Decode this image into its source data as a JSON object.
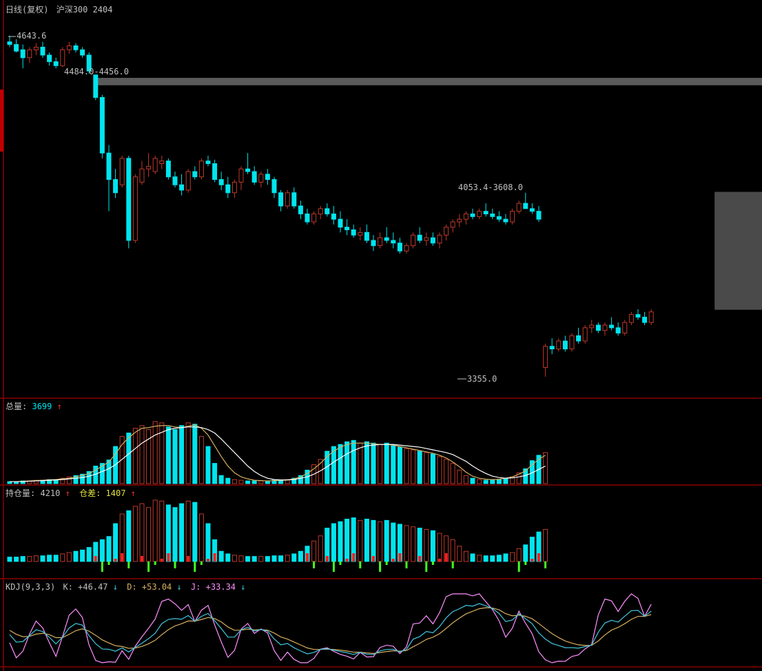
{
  "header": {
    "period": "日线(复权)",
    "symbol": "沪深300 2404"
  },
  "colors": {
    "background": "#000000",
    "border": "#8b0000",
    "up": "#c0392b",
    "down": "#00e5ee",
    "label": "#c0c0c0",
    "gap_box": "#4a4a4a",
    "kdj_k": "#ff90ff",
    "kdj_d": "#d8b060",
    "kdj_j": "#40c8e0",
    "vol_ma1": "#d8b060",
    "vol_ma2": "#ffffff",
    "oi_change_pos": "#ff2020",
    "oi_change_neg": "#44ff22"
  },
  "annotations": {
    "high": "4643.6",
    "gap1": "4484.0-4456.0",
    "gap2": "4053.4-3608.0",
    "low": "3355.0"
  },
  "volume_panel": {
    "label": "总量:",
    "value": "3699",
    "arrow": "↑"
  },
  "oi_panel": {
    "label": "持仓量:",
    "value": "4210",
    "arrow1": "↑",
    "label2": "仓差:",
    "value2": "1407",
    "arrow2": "↑"
  },
  "kdj_panel": {
    "label": "KDJ(9,3,3)",
    "k_label": "K:",
    "k_value": "+46.47",
    "k_arrow": "↓",
    "d_label": "D:",
    "d_value": "+53.04",
    "d_arrow": "↓",
    "j_label": "J:",
    "j_value": "+33.34",
    "j_arrow": "↓"
  },
  "chart_data": {
    "type": "candlestick",
    "ylim": [
      3300,
      4700
    ],
    "gaps": [
      {
        "high": 4484.0,
        "low": 4456.0,
        "start_index": 13
      },
      {
        "high": 4053.4,
        "low": 3608.0,
        "start_index": 107
      }
    ],
    "candles": [
      [
        4620,
        4643.6,
        4600,
        4610
      ],
      [
        4610,
        4630,
        4580,
        4585
      ],
      [
        4590,
        4610,
        4520,
        4560
      ],
      [
        4560,
        4600,
        4540,
        4590
      ],
      [
        4590,
        4615,
        4570,
        4600
      ],
      [
        4600,
        4620,
        4560,
        4570
      ],
      [
        4570,
        4580,
        4530,
        4545
      ],
      [
        4545,
        4560,
        4520,
        4530
      ],
      [
        4530,
        4600,
        4525,
        4590
      ],
      [
        4590,
        4620,
        4575,
        4605
      ],
      [
        4605,
        4615,
        4580,
        4590
      ],
      [
        4590,
        4600,
        4560,
        4570
      ],
      [
        4570,
        4580,
        4500,
        4510
      ],
      [
        4495,
        4484,
        4400,
        4410
      ],
      [
        4410,
        4420,
        4180,
        4200
      ],
      [
        4200,
        4230,
        3980,
        4100
      ],
      [
        4100,
        4140,
        4030,
        4050
      ],
      [
        4080,
        4190,
        4070,
        4180
      ],
      [
        4180,
        4190,
        3840,
        3870
      ],
      [
        3870,
        4120,
        3860,
        4110
      ],
      [
        4090,
        4170,
        4080,
        4140
      ],
      [
        4140,
        4200,
        4110,
        4150
      ],
      [
        4130,
        4190,
        4120,
        4180
      ],
      [
        4160,
        4190,
        4140,
        4170
      ],
      [
        4170,
        4180,
        4100,
        4110
      ],
      [
        4110,
        4130,
        4070,
        4080
      ],
      [
        4080,
        4120,
        4040,
        4060
      ],
      [
        4060,
        4140,
        4050,
        4130
      ],
      [
        4130,
        4150,
        4100,
        4110
      ],
      [
        4110,
        4180,
        4100,
        4170
      ],
      [
        4170,
        4190,
        4150,
        4160
      ],
      [
        4160,
        4175,
        4090,
        4100
      ],
      [
        4100,
        4130,
        4060,
        4080
      ],
      [
        4080,
        4110,
        4030,
        4050
      ],
      [
        4050,
        4100,
        4030,
        4090
      ],
      [
        4090,
        4150,
        4060,
        4140
      ],
      [
        4140,
        4200,
        4120,
        4130
      ],
      [
        4130,
        4150,
        4080,
        4090
      ],
      [
        4090,
        4130,
        4070,
        4120
      ],
      [
        4120,
        4140,
        4080,
        4100
      ],
      [
        4100,
        4110,
        4030,
        4050
      ],
      [
        4050,
        4060,
        3980,
        4000
      ],
      [
        4000,
        4060,
        3990,
        4050
      ],
      [
        4050,
        4070,
        3990,
        4000
      ],
      [
        4000,
        4020,
        3950,
        3970
      ],
      [
        3970,
        3990,
        3930,
        3940
      ],
      [
        3940,
        3980,
        3930,
        3970
      ],
      [
        3970,
        4000,
        3950,
        3990
      ],
      [
        3990,
        4010,
        3960,
        3970
      ],
      [
        3970,
        4000,
        3930,
        3950
      ],
      [
        3950,
        3980,
        3900,
        3920
      ],
      [
        3920,
        3950,
        3890,
        3910
      ],
      [
        3910,
        3930,
        3880,
        3890
      ],
      [
        3890,
        3920,
        3870,
        3900
      ],
      [
        3900,
        3930,
        3860,
        3870
      ],
      [
        3870,
        3890,
        3830,
        3850
      ],
      [
        3850,
        3900,
        3840,
        3880
      ],
      [
        3880,
        3920,
        3860,
        3870
      ],
      [
        3870,
        3900,
        3840,
        3860
      ],
      [
        3860,
        3880,
        3820,
        3830
      ],
      [
        3830,
        3860,
        3820,
        3850
      ],
      [
        3850,
        3900,
        3840,
        3890
      ],
      [
        3890,
        3920,
        3860,
        3870
      ],
      [
        3870,
        3900,
        3850,
        3880
      ],
      [
        3880,
        3900,
        3850,
        3860
      ],
      [
        3860,
        3900,
        3840,
        3890
      ],
      [
        3890,
        3930,
        3870,
        3920
      ],
      [
        3920,
        3950,
        3900,
        3940
      ],
      [
        3940,
        3970,
        3920,
        3950
      ],
      [
        3950,
        3980,
        3930,
        3970
      ],
      [
        3970,
        3990,
        3950,
        3960
      ],
      [
        3960,
        3990,
        3950,
        3980
      ],
      [
        3980,
        4010,
        3960,
        3970
      ],
      [
        3970,
        3990,
        3950,
        3960
      ],
      [
        3960,
        3980,
        3940,
        3950
      ],
      [
        3950,
        3970,
        3930,
        3940
      ],
      [
        3940,
        3990,
        3930,
        3980
      ],
      [
        3980,
        4020,
        3970,
        4010
      ],
      [
        4010,
        4050,
        4000,
        3990
      ],
      [
        3990,
        4010,
        3970,
        3980
      ],
      [
        3980,
        4000,
        3940,
        3950
      ],
      [
        3390,
        3480,
        3355,
        3470
      ],
      [
        3470,
        3500,
        3440,
        3460
      ],
      [
        3460,
        3500,
        3450,
        3490
      ],
      [
        3490,
        3510,
        3450,
        3460
      ],
      [
        3460,
        3520,
        3450,
        3510
      ],
      [
        3510,
        3540,
        3480,
        3490
      ],
      [
        3490,
        3550,
        3480,
        3540
      ],
      [
        3540,
        3570,
        3520,
        3550
      ],
      [
        3550,
        3560,
        3520,
        3530
      ],
      [
        3530,
        3560,
        3510,
        3550
      ],
      [
        3550,
        3580,
        3530,
        3540
      ],
      [
        3540,
        3560,
        3510,
        3520
      ],
      [
        3520,
        3570,
        3510,
        3560
      ],
      [
        3560,
        3600,
        3550,
        3590
      ],
      [
        3590,
        3610,
        3570,
        3580
      ],
      [
        3580,
        3600,
        3550,
        3560
      ],
      [
        3560,
        3610,
        3550,
        3600
      ]
    ],
    "volume": [
      3,
      3,
      4,
      4,
      5,
      5,
      6,
      6,
      8,
      10,
      12,
      14,
      18,
      26,
      30,
      35,
      55,
      70,
      75,
      82,
      86,
      80,
      92,
      90,
      84,
      80,
      86,
      90,
      88,
      70,
      55,
      30,
      12,
      8,
      6,
      5,
      4,
      4,
      4,
      4,
      5,
      5,
      6,
      8,
      12,
      20,
      28,
      36,
      48,
      55,
      58,
      62,
      64,
      60,
      62,
      60,
      58,
      60,
      56,
      54,
      52,
      50,
      48,
      46,
      44,
      40,
      36,
      30,
      20,
      12,
      8,
      6,
      5,
      5,
      6,
      8,
      10,
      16,
      22,
      34,
      42,
      46
    ],
    "vol_ma1": [
      3,
      3,
      3.5,
      4,
      4.5,
      5,
      5.5,
      6,
      7,
      8,
      10,
      12,
      15,
      20,
      26,
      32,
      44,
      58,
      68,
      76,
      82,
      83,
      85,
      86,
      86,
      84,
      83,
      85,
      87,
      82,
      72,
      56,
      40,
      26,
      16,
      10,
      7,
      5,
      4.5,
      4,
      4.5,
      5,
      5.5,
      7,
      10,
      15,
      22,
      30,
      40,
      48,
      54,
      58,
      60,
      60,
      60,
      59,
      58,
      58,
      57,
      55,
      53,
      51,
      49,
      47,
      45,
      42,
      38,
      32,
      25,
      17,
      11,
      8,
      6.5,
      6,
      6.5,
      8,
      10,
      14,
      19,
      28,
      36,
      42
    ],
    "vol_ma2": [
      3,
      3,
      3,
      3.5,
      4,
      4.5,
      5,
      5.5,
      6,
      7,
      8,
      9,
      11,
      14,
      18,
      22,
      28,
      36,
      44,
      52,
      60,
      66,
      72,
      76,
      80,
      82,
      83,
      84,
      84,
      83,
      80,
      75,
      66,
      56,
      46,
      36,
      26,
      18,
      12,
      8,
      6,
      5.5,
      5.5,
      6,
      8,
      10,
      14,
      19,
      25,
      32,
      38,
      44,
      49,
      53,
      56,
      57,
      58,
      58,
      58,
      57,
      56,
      55,
      54,
      52,
      50,
      48,
      46,
      43,
      38,
      33,
      26,
      20,
      15,
      11,
      9,
      8,
      8.5,
      10,
      12,
      16,
      21,
      26
    ]
  }
}
